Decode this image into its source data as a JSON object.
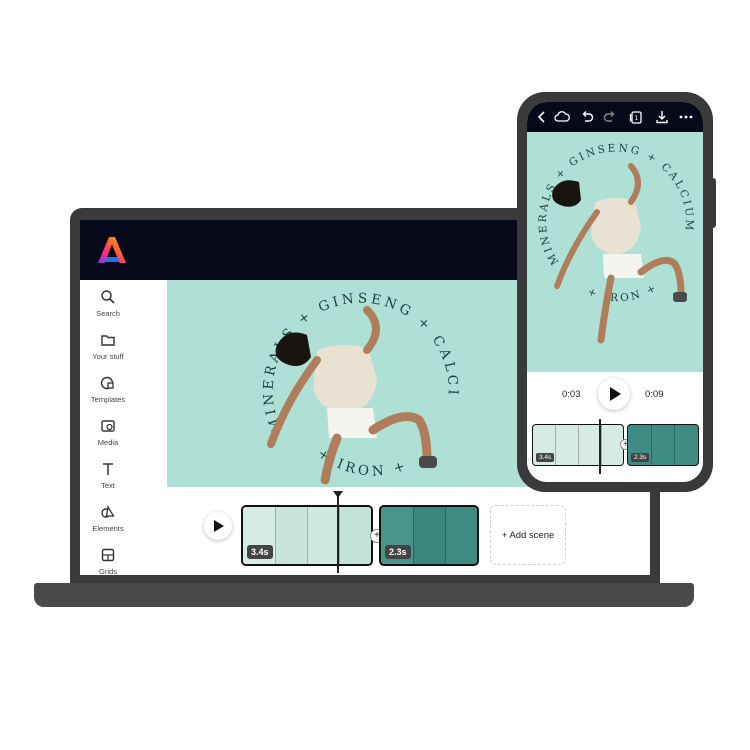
{
  "sidebar": {
    "items": [
      {
        "label": "Search",
        "icon": "search-icon"
      },
      {
        "label": "Your stuff",
        "icon": "folder-icon"
      },
      {
        "label": "Templates",
        "icon": "templates-icon"
      },
      {
        "label": "Media",
        "icon": "media-icon"
      },
      {
        "label": "Text",
        "icon": "text-icon"
      },
      {
        "label": "Elements",
        "icon": "elements-icon"
      },
      {
        "label": "Grids",
        "icon": "grids-icon"
      }
    ]
  },
  "canvas": {
    "words_top": "MINERALS + GINSENG + CALCIUM +",
    "words_bottom": "+ IRON +",
    "background": "#aee0d6",
    "text_color": "#1b3d3a"
  },
  "timeline": {
    "clips": [
      {
        "duration": "3.4s",
        "theme": "light"
      },
      {
        "duration": "2.3s",
        "theme": "dark"
      }
    ],
    "add_scene_label": "+ Add scene"
  },
  "phone": {
    "current_time": "0:03",
    "total_time": "0:09",
    "clips": [
      {
        "duration": "3.4s"
      },
      {
        "duration": "2.3s"
      }
    ],
    "toolbar_icons": [
      "back-icon",
      "cloud-icon",
      "undo-icon",
      "redo-icon",
      "pages-icon",
      "download-icon",
      "more-icon"
    ]
  },
  "colors": {
    "header_bg": "#06091a",
    "device_frame": "#3a3a3a",
    "mint": "#aee0d6",
    "clip_dark": "#3e8c84"
  }
}
